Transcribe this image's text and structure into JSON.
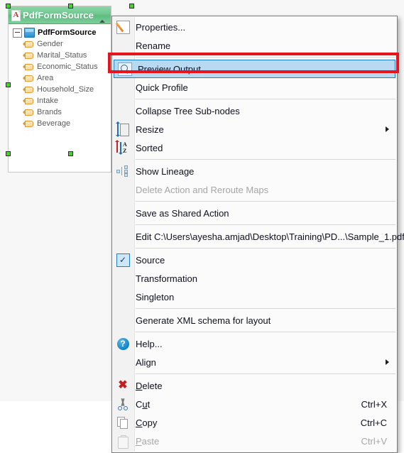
{
  "node": {
    "title": "PdfFormSource",
    "title_icon": "pdf-file-icon",
    "collapse_icon": "triangle-up-icon",
    "tree": {
      "root": {
        "label": "PdfFormSource",
        "expander_icon": "minus-expander-icon",
        "icon": "blue-object-icon"
      },
      "fields": [
        {
          "label": "Gender",
          "icon": "field-tag-icon"
        },
        {
          "label": "Marital_Status",
          "icon": "field-tag-icon"
        },
        {
          "label": "Economic_Status",
          "icon": "field-tag-icon"
        },
        {
          "label": "Area",
          "icon": "field-tag-icon"
        },
        {
          "label": "Household_Size",
          "icon": "field-tag-icon"
        },
        {
          "label": "Intake",
          "icon": "field-tag-icon"
        },
        {
          "label": "Brands",
          "icon": "field-tag-icon"
        },
        {
          "label": "Beverage",
          "icon": "field-tag-icon"
        }
      ]
    }
  },
  "context_menu": {
    "items": [
      {
        "label": "Properties...",
        "icon": "edit-properties-icon",
        "accel": "",
        "state": "normal"
      },
      {
        "label": "Rename",
        "icon": "",
        "accel": "",
        "state": "normal"
      },
      {
        "label": "Preview Output",
        "icon": "preview-magnifier-icon",
        "accel": "",
        "state": "selected"
      },
      {
        "label": "Quick Profile",
        "icon": "",
        "accel": "",
        "state": "normal"
      },
      {
        "label": "Collapse Tree Sub-nodes",
        "icon": "",
        "accel": "",
        "state": "normal"
      },
      {
        "label": "Resize",
        "icon": "resize-icon",
        "accel": "",
        "state": "submenu"
      },
      {
        "label": "Sorted",
        "icon": "sort-az-icon",
        "accel": "",
        "state": "normal"
      },
      {
        "label": "Show Lineage",
        "icon": "lineage-icon",
        "accel": "",
        "state": "normal"
      },
      {
        "label": "Delete Action and Reroute Maps",
        "icon": "",
        "accel": "",
        "state": "disabled"
      },
      {
        "label": "Save as Shared Action",
        "icon": "",
        "accel": "",
        "state": "normal"
      },
      {
        "label": "Edit C:\\Users\\ayesha.amjad\\Desktop\\Training\\PD...\\Sample_1.pdf",
        "icon": "",
        "accel": "",
        "state": "normal"
      },
      {
        "label": "Source",
        "icon": "checkbox-checked-icon",
        "accel": "",
        "state": "checked"
      },
      {
        "label": "Transformation",
        "icon": "",
        "accel": "",
        "state": "normal"
      },
      {
        "label": "Singleton",
        "icon": "",
        "accel": "",
        "state": "normal"
      },
      {
        "label": "Generate XML schema for layout",
        "icon": "",
        "accel": "",
        "state": "normal"
      },
      {
        "label": "Help...",
        "icon": "help-icon",
        "accel": "",
        "state": "normal"
      },
      {
        "label": "Align",
        "icon": "",
        "accel": "",
        "state": "submenu"
      },
      {
        "label": "Delete",
        "icon": "delete-x-icon",
        "accel": "",
        "state": "normal",
        "mnemonic": "D"
      },
      {
        "label": "Cut",
        "icon": "cut-scissors-icon",
        "accel": "Ctrl+X",
        "state": "normal",
        "mnemonic": "u"
      },
      {
        "label": "Copy",
        "icon": "copy-pages-icon",
        "accel": "Ctrl+C",
        "state": "normal",
        "mnemonic": "C"
      },
      {
        "label": "Paste",
        "icon": "paste-clipboard-icon",
        "accel": "Ctrl+V",
        "state": "disabled",
        "mnemonic": "P"
      }
    ],
    "checkbox_glyph": "✓",
    "help_glyph": "?",
    "delete_glyph": "✖"
  },
  "annotation": {
    "highlight_color": "#e8141c",
    "target": "Preview Output"
  },
  "colors": {
    "node_header_green": "#6ec68e",
    "selection_handle_green": "#41d820",
    "menu_selected_blue": "#b8d9f2",
    "menu_selected_border": "#1f7fc4"
  }
}
